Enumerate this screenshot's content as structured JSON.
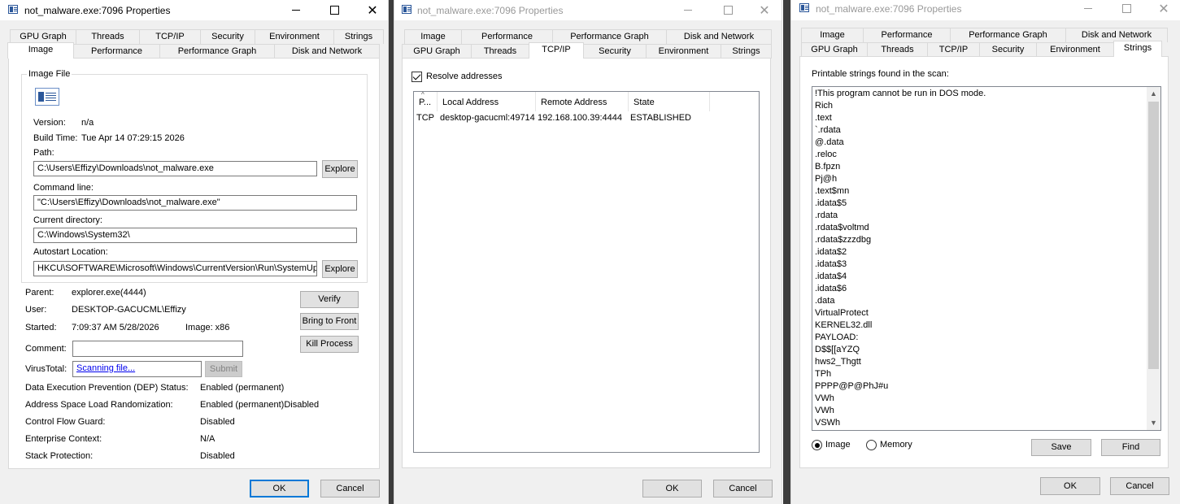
{
  "window1": {
    "title": "not_malware.exe:7096 Properties",
    "tabs_back": [
      "GPU Graph",
      "Threads",
      "TCP/IP",
      "Security",
      "Environment",
      "Strings"
    ],
    "tabs_front": [
      "Image",
      "Performance",
      "Performance Graph",
      "Disk and Network"
    ],
    "selected_tab": "Image",
    "image_file_legend": "Image File",
    "version_label": "Version:",
    "version_value": "n/a",
    "build_time_label": "Build Time:",
    "build_time_value": "Tue Apr 14 07:29:15 2026",
    "path_label": "Path:",
    "path_value": "C:\\Users\\Effizy\\Downloads\\not_malware.exe",
    "explore_label": "Explore",
    "command_line_label": "Command line:",
    "command_line_value": "\"C:\\Users\\Effizy\\Downloads\\not_malware.exe\"",
    "current_dir_label": "Current directory:",
    "current_dir_value": "C:\\Windows\\System32\\",
    "autostart_label": "Autostart Location:",
    "autostart_value": "HKCU\\SOFTWARE\\Microsoft\\Windows\\CurrentVersion\\Run\\SystemUpdate",
    "parent_label": "Parent:",
    "parent_value": "explorer.exe(4444)",
    "user_label": "User:",
    "user_value": "DESKTOP-GACUCML\\Effizy",
    "started_label": "Started:",
    "started_value": "7:09:37 AM   5/28/2026",
    "image_label": "Image: x86",
    "verify_label": "Verify",
    "bring_to_front_label": "Bring to Front",
    "kill_process_label": "Kill Process",
    "comment_label": "Comment:",
    "comment_value": "",
    "virustotal_label": "VirusTotal:",
    "virustotal_link": "Scanning file...",
    "submit_label": "Submit",
    "dep_label": "Data Execution Prevention (DEP) Status:",
    "dep_value": "Enabled (permanent)",
    "aslr_label": "Address Space Load Randomization:",
    "aslr_value": "Enabled (permanent)Disabled",
    "cfg_label": "Control Flow Guard:",
    "cfg_value": "Disabled",
    "enterprise_label": "Enterprise Context:",
    "enterprise_value": "N/A",
    "stack_label": "Stack Protection:",
    "stack_value": "Disabled",
    "ok_label": "OK",
    "cancel_label": "Cancel"
  },
  "window2": {
    "title": "not_malware.exe:7096 Properties",
    "tabs_back": [
      "Image",
      "Performance",
      "Performance Graph",
      "Disk and Network"
    ],
    "tabs_front": [
      "GPU Graph",
      "Threads",
      "TCP/IP",
      "Security",
      "Environment",
      "Strings"
    ],
    "selected_tab": "TCP/IP",
    "resolve_label": "Resolve addresses",
    "resolve_checked": true,
    "columns": [
      "P...",
      "Local Address",
      "Remote Address",
      "State"
    ],
    "rows": [
      [
        "TCP",
        "desktop-gacucml:49714",
        "192.168.100.39:4444",
        "ESTABLISHED"
      ]
    ],
    "ok_label": "OK",
    "cancel_label": "Cancel"
  },
  "window3": {
    "title": "not_malware.exe:7096 Properties",
    "tabs_back": [
      "Image",
      "Performance",
      "Performance Graph",
      "Disk and Network"
    ],
    "tabs_front": [
      "GPU Graph",
      "Threads",
      "TCP/IP",
      "Security",
      "Environment",
      "Strings"
    ],
    "selected_tab": "Strings",
    "strings_label": "Printable strings found in the scan:",
    "strings": [
      "!This program cannot be run in DOS mode.",
      "Rich",
      ".text",
      "`.rdata",
      "@.data",
      ".reloc",
      "B.fpzn",
      "Pj@h",
      ".text$mn",
      ".idata$5",
      ".rdata",
      ".rdata$voltmd",
      ".rdata$zzzdbg",
      ".idata$2",
      ".idata$3",
      ".idata$4",
      ".idata$6",
      ".data",
      "VirtualProtect",
      "KERNEL32.dll",
      "PAYLOAD:",
      "D$$[[aYZQ",
      "hws2_Thgtt",
      "TPh",
      "PPPP@P@PhJ#u",
      "VWh",
      "VWh",
      "VSWh"
    ],
    "radio_image_label": "Image",
    "radio_memory_label": "Memory",
    "selected_radio": "Image",
    "save_label": "Save",
    "find_label": "Find",
    "ok_label": "OK",
    "cancel_label": "Cancel"
  }
}
